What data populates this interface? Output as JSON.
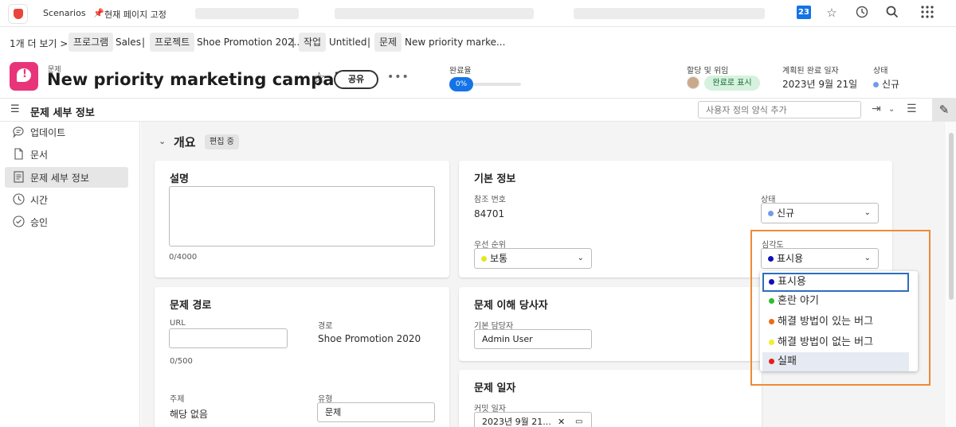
{
  "topbar": {
    "app_name": "Scenarios",
    "pin_page": "현재 페이지 고정",
    "calendar_day": "23",
    "icons": [
      "calendar-icon",
      "star-icon",
      "history-icon",
      "search-icon",
      "apps-grid-icon"
    ]
  },
  "breadcrumb": {
    "more": "1개 더 보기 >",
    "items": [
      {
        "type": "프로그램",
        "name": "Sales"
      },
      {
        "type": "프로젝트",
        "name": "Shoe Promotion 202..."
      },
      {
        "type": "작업",
        "name": "Untitled"
      },
      {
        "type": "문제",
        "name": "New priority marke..."
      }
    ],
    "separator": "|"
  },
  "header": {
    "object_type": "문제",
    "title": "New priority marketing campaign",
    "share_label": "공유",
    "more_label": "•••",
    "progress_label": "완료율",
    "progress_value": "0%",
    "progress_fraction": 0,
    "assign_label": "할당 및 위임",
    "mark_done_label": "완료로 표시",
    "planned_label": "계획된 완료 일자",
    "planned_value": "2023년 9월 21일",
    "status_label": "상태",
    "status_value": "신규",
    "status_color": "#6f9ee6",
    "accent_color": "#1473e6",
    "issue_icon_color": "#e8357a"
  },
  "detail_bar": {
    "title": "문제 세부 정보",
    "custom_form_placeholder": "사용자 정의 양식 추가"
  },
  "sidebar": {
    "items": [
      {
        "label": "업데이트",
        "icon": "chat-bubble-icon",
        "active": false
      },
      {
        "label": "문서",
        "icon": "document-icon",
        "active": false
      },
      {
        "label": "문제 세부 정보",
        "icon": "details-icon",
        "active": true
      },
      {
        "label": "시간",
        "icon": "clock-icon",
        "active": false
      },
      {
        "label": "승인",
        "icon": "checkmark-circle-icon",
        "active": false
      }
    ]
  },
  "section": {
    "title": "개요",
    "editing_tag": "편집 중"
  },
  "description_card": {
    "title": "설명",
    "char_count": "0/4000"
  },
  "basic_info_card": {
    "title": "기본 정보",
    "ref_label": "참조 번호",
    "ref_value": "84701",
    "status_label": "상태",
    "status_value": "신규",
    "priority_label": "우선 순위",
    "priority_value": "보통",
    "priority_color": "#e3e624",
    "severity_label": "심각도",
    "severity_value": "표시용",
    "severity_color": "#1010b8"
  },
  "severity_dropdown": {
    "options": [
      {
        "label": "표시용",
        "color": "#1010b8"
      },
      {
        "label": "혼란 야기",
        "color": "#2cbf2c"
      },
      {
        "label": "해결 방법이 있는 버그",
        "color": "#ee6a16"
      },
      {
        "label": "해결 방법이 없는 버그",
        "color": "#f1ee2c"
      },
      {
        "label": "실패",
        "color": "#e81c1c"
      }
    ],
    "highlight_color": "#ef8a37"
  },
  "route_card": {
    "title": "문제 경로",
    "url_label": "URL",
    "url_count": "0/500",
    "path_label": "경로",
    "path_value": "Shoe Promotion 2020",
    "topic_label": "주제",
    "topic_value": "해당 없음",
    "type_label": "유형",
    "type_value": "문제"
  },
  "stakeholder_card": {
    "title": "문제 이해 당사자",
    "owner_label": "기본 담당자",
    "owner_value": "Admin User"
  },
  "dates_card": {
    "title": "문제 일자",
    "commit_label": "커밋 일자",
    "commit_value": "2023년 9월 21..."
  }
}
